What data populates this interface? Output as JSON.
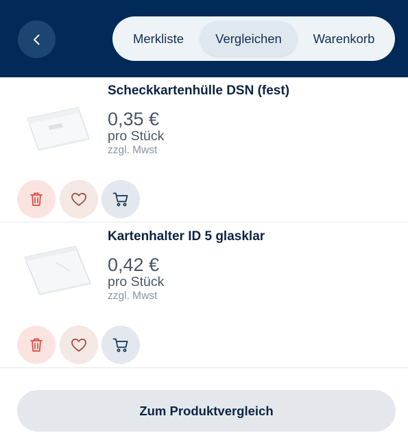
{
  "header": {
    "tabs": [
      {
        "label": "Merkliste"
      },
      {
        "label": "Vergleichen"
      },
      {
        "label": "Warenkorb"
      }
    ],
    "active_tab": "Vergleichen"
  },
  "products": [
    {
      "title": "Scheckkartenhülle DSN (fest)",
      "price": "0,35 €",
      "unit": "pro Stück",
      "tax_note": "zzgl. Mwst"
    },
    {
      "title": "Kartenhalter ID 5 glasklar",
      "price": "0,42 €",
      "unit": "pro Stück",
      "tax_note": "zzgl. Mwst"
    }
  ],
  "actions": {
    "icons": [
      "trash-icon",
      "heart-icon",
      "cart-icon"
    ]
  },
  "cta": {
    "label": "Zum Produktvergleich"
  },
  "colors": {
    "header_bg": "#022a58",
    "delete_accent": "#d9493a",
    "favorite_accent": "#a04432",
    "text_dark": "#0b2442"
  }
}
